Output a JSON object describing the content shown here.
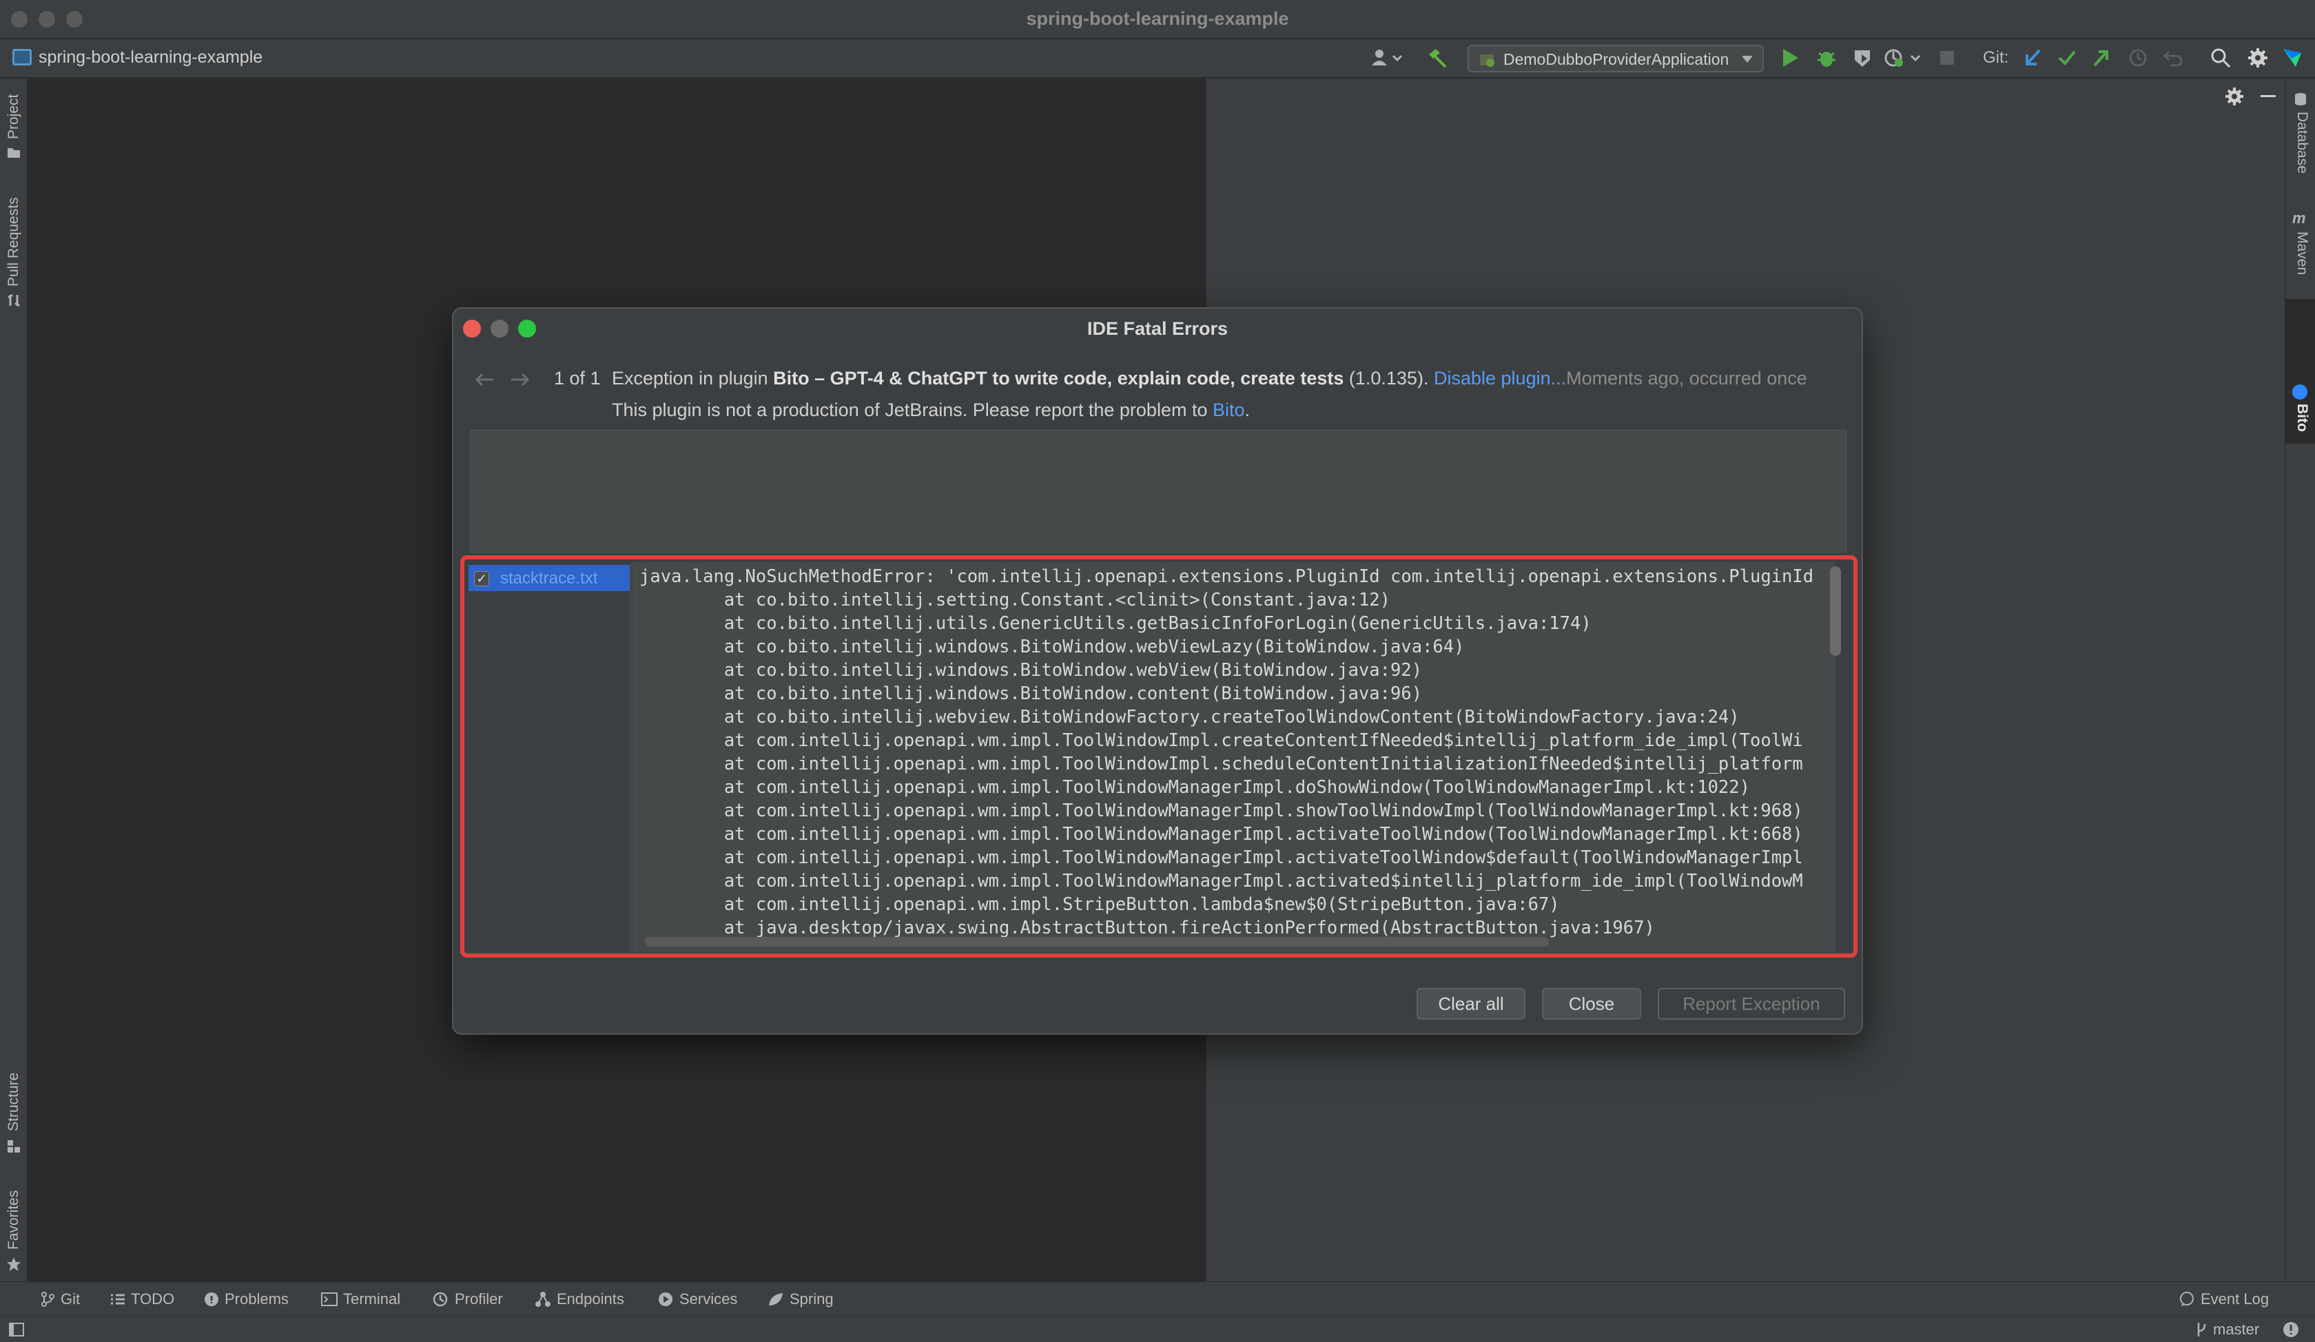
{
  "window": {
    "title": "spring-boot-learning-example"
  },
  "navbar": {
    "project_name": "spring-boot-learning-example",
    "run_config": "DemoDubboProviderApplication",
    "git_label": "Git:"
  },
  "left_stripe": {
    "top": [
      "Project",
      "Pull Requests"
    ],
    "bottom": [
      "Structure",
      "Favorites"
    ]
  },
  "right_stripe": [
    "Database",
    "Maven",
    "Bito"
  ],
  "dialog": {
    "title": "IDE Fatal Errors",
    "counter": "1 of 1",
    "exception_prefix": "Exception in plugin",
    "plugin_name": "Bito – GPT-4 & ChatGPT to write code, explain code, create tests",
    "plugin_version": "(1.0.135).",
    "disable_link": "Disable plugin...",
    "time_info": "Moments ago, occurred once",
    "report_text": "This plugin is not a production of JetBrains. Please report the problem to",
    "report_link": "Bito",
    "report_suffix": ".",
    "attachment": "stacktrace.txt",
    "stacktrace": [
      "java.lang.NoSuchMethodError: 'com.intellij.openapi.extensions.PluginId com.intellij.openapi.extensions.PluginId",
      "        at co.bito.intellij.setting.Constant.<clinit>(Constant.java:12)",
      "        at co.bito.intellij.utils.GenericUtils.getBasicInfoForLogin(GenericUtils.java:174)",
      "        at co.bito.intellij.windows.BitoWindow.webViewLazy(BitoWindow.java:64)",
      "        at co.bito.intellij.windows.BitoWindow.webView(BitoWindow.java:92)",
      "        at co.bito.intellij.windows.BitoWindow.content(BitoWindow.java:96)",
      "        at co.bito.intellij.webview.BitoWindowFactory.createToolWindowContent(BitoWindowFactory.java:24)",
      "        at com.intellij.openapi.wm.impl.ToolWindowImpl.createContentIfNeeded$intellij_platform_ide_impl(ToolWi",
      "        at com.intellij.openapi.wm.impl.ToolWindowImpl.scheduleContentInitializationIfNeeded$intellij_platform",
      "        at com.intellij.openapi.wm.impl.ToolWindowManagerImpl.doShowWindow(ToolWindowManagerImpl.kt:1022)",
      "        at com.intellij.openapi.wm.impl.ToolWindowManagerImpl.showToolWindowImpl(ToolWindowManagerImpl.kt:968)",
      "        at com.intellij.openapi.wm.impl.ToolWindowManagerImpl.activateToolWindow(ToolWindowManagerImpl.kt:668)",
      "        at com.intellij.openapi.wm.impl.ToolWindowManagerImpl.activateToolWindow$default(ToolWindowManagerImpl",
      "        at com.intellij.openapi.wm.impl.ToolWindowManagerImpl.activated$intellij_platform_ide_impl(ToolWindowM",
      "        at com.intellij.openapi.wm.impl.StripeButton.lambda$new$0(StripeButton.java:67)",
      "        at java.desktop/javax.swing.AbstractButton.fireActionPerformed(AbstractButton.java:1967)"
    ],
    "buttons": {
      "clear_all": "Clear all",
      "close": "Close",
      "report": "Report Exception"
    }
  },
  "bottom_tabs": [
    "Git",
    "TODO",
    "Problems",
    "Terminal",
    "Profiler",
    "Endpoints",
    "Services",
    "Spring"
  ],
  "event_log": "Event Log",
  "status": {
    "branch": "master"
  },
  "colors": {
    "accent_link": "#589df6",
    "error_frame": "#e0403e",
    "selection": "#2f65ca"
  }
}
